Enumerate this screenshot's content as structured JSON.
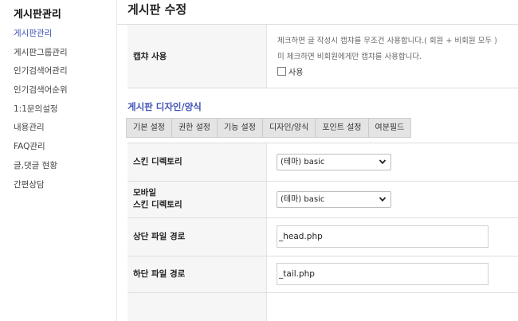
{
  "sidebar": {
    "title": "게시판관리",
    "items": [
      {
        "label": "게시판관리"
      },
      {
        "label": "게시판그룹관리"
      },
      {
        "label": "인기검색어관리"
      },
      {
        "label": "인기검색어순위"
      },
      {
        "label": "1:1문의설정"
      },
      {
        "label": "내용관리"
      },
      {
        "label": "FAQ관리"
      },
      {
        "label": "글,댓글 현황"
      },
      {
        "label": "간편상담"
      }
    ]
  },
  "main": {
    "title": "게시판 수정",
    "captcha": {
      "label": "캡챠 사용",
      "help_line1": "체크하면 글 작성시 캡챠를 무조건 사용합니다.( 회원 + 비회원 모두 )",
      "help_line2": "미 체크하면 비회원에게만 캡챠를 사용합니다.",
      "checkbox_label": "사용"
    },
    "design_section_title": "게시판 디자인/양식",
    "tabs": [
      {
        "label": "기본 설정"
      },
      {
        "label": "권한 설정"
      },
      {
        "label": "기능 설정"
      },
      {
        "label": "디자인/양식"
      },
      {
        "label": "포인트 설정"
      },
      {
        "label": "여분필드"
      }
    ],
    "skin_dir": {
      "label": "스킨 디렉토리",
      "value": "(테마) basic"
    },
    "mobile_skin_dir": {
      "label_line1": "모바일",
      "label_line2": "스킨 디렉토리",
      "value": "(테마) basic"
    },
    "head_file": {
      "label": "상단 파일 경로",
      "value": "_head.php"
    },
    "tail_file": {
      "label": "하단 파일 경로",
      "value": "_tail.php"
    }
  }
}
